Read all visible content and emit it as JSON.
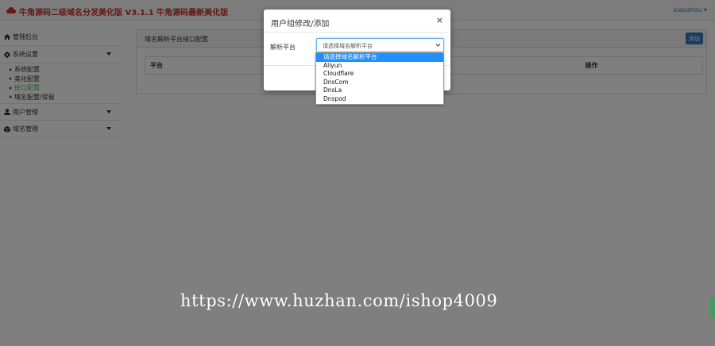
{
  "app": {
    "title": "牛角源码二级域名分发美化版 V3.1.1 牛角源码最新美化版",
    "user": "xiaozhou",
    "colors": {
      "brand": "#c9302c",
      "primary": "#337ab7",
      "active": "#5cb85c",
      "select_highlight": "#1e90ff"
    }
  },
  "sidebar": {
    "dashboard": {
      "label": "管理后台",
      "icon": "home-icon"
    },
    "system": {
      "label": "系统设置",
      "icon": "gear-icon",
      "items": [
        {
          "label": "系统配置"
        },
        {
          "label": "美化配置"
        },
        {
          "label": "接口配置"
        },
        {
          "label": "域名配置/保留"
        }
      ]
    },
    "users": {
      "label": "用户管理",
      "icon": "user-icon"
    },
    "domains": {
      "label": "域名管理",
      "icon": "cube-icon"
    }
  },
  "main": {
    "heading": "域名解析平台接口配置",
    "add_button": "添加",
    "columns": [
      "平台",
      "操作"
    ]
  },
  "modal": {
    "title": "用户组修改/添加",
    "close": "×",
    "field_label": "解析平台",
    "select_value": "请选择域名解析平台",
    "options": [
      "请选择域名解析平台",
      "Aliyun",
      "Cloudflare",
      "DnsCom",
      "DnsLa",
      "Dnspod"
    ]
  },
  "watermark": "https://www.huzhan.com/ishop4009"
}
